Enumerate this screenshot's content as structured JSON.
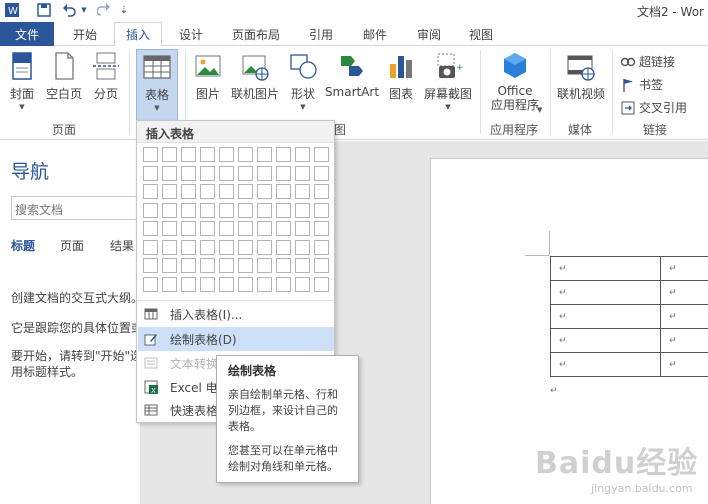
{
  "window": {
    "title": "文档2 - Wor"
  },
  "quick_access": {
    "icons": [
      "word-logo-icon",
      "save-icon",
      "undo-icon",
      "undo-dropdown-icon",
      "redo-icon",
      "customize-toolbar-icon"
    ]
  },
  "tabs": {
    "file": "文件",
    "items": [
      {
        "label": "开始"
      },
      {
        "label": "插入"
      },
      {
        "label": "设计"
      },
      {
        "label": "页面布局"
      },
      {
        "label": "引用"
      },
      {
        "label": "邮件"
      },
      {
        "label": "审阅"
      },
      {
        "label": "视图"
      }
    ],
    "active": "插入"
  },
  "ribbon": {
    "pages_group": {
      "label": "页面",
      "cover": "封面",
      "blank": "空白页",
      "break": "分页"
    },
    "tables_group": {
      "table": "表格"
    },
    "illustrations_group": {
      "label_visible": "图",
      "picture": "图片",
      "online_picture": "联机图片",
      "shapes": "形状",
      "smartart": "SmartArt",
      "chart": "图表",
      "screenshot": "屏幕截图"
    },
    "apps_group": {
      "label": "应用程序",
      "office_line1": "Office",
      "office_line2": "应用程序"
    },
    "media_group": {
      "label": "媒体",
      "online_video": "联机视频"
    },
    "links_group": {
      "label": "链接",
      "hyperlink": "超链接",
      "bookmark": "书签",
      "crossref": "交叉引用"
    }
  },
  "navigation": {
    "title": "导航",
    "search_placeholder": "搜索文档",
    "tabs": [
      "标题",
      "页面",
      "结果"
    ],
    "text1": "创建文档的交互式大纲。",
    "text2": "它是跟踪您的具体位置或",
    "text3": "要开始，请转到\"开始\"选",
    "text4": "用标题样式。"
  },
  "table_dropdown": {
    "header": "插入表格",
    "grid_columns": 10,
    "grid_rows": 8,
    "items": [
      {
        "label": "插入表格(I)...",
        "icon": "insert-table-icon",
        "state": "normal"
      },
      {
        "label": "绘制表格(D)",
        "icon": "draw-table-icon",
        "state": "hover"
      },
      {
        "label": "文本转换",
        "icon": "convert-text-icon",
        "state": "disabled"
      },
      {
        "label": "Excel 电子",
        "icon": "excel-icon",
        "state": "normal"
      },
      {
        "label": "快速表格",
        "icon": "quick-table-icon",
        "state": "normal"
      }
    ]
  },
  "tooltip": {
    "title": "绘制表格",
    "body1": "亲自绘制单元格、行和列边框，来设计自己的表格。",
    "body2": "您甚至可以在单元格中绘制对角线和单元格。"
  },
  "document": {
    "table_rows": 5,
    "cell_mark": "↵",
    "after_mark": "↵"
  },
  "watermark": {
    "logo": "Baidu经验",
    "sub": "jingyan.baidu.com"
  },
  "colors": {
    "accent": "#2b579a",
    "file_tab": "#2b579a",
    "hover": "#cde0f7",
    "selected_button": "#c5d7ef"
  }
}
